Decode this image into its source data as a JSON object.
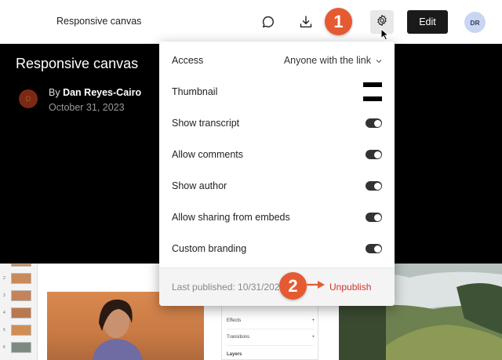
{
  "header": {
    "title": "Responsive canvas",
    "icons": [
      "comment-icon",
      "download-icon",
      "gear-icon"
    ],
    "edit_label": "Edit",
    "avatar_initials": "DR"
  },
  "hero": {
    "title": "Responsive canvas",
    "author_initial": "D",
    "by_prefix": "By",
    "author_name": "Dan Reyes-Cairo",
    "date": "October 31, 2023"
  },
  "callouts": [
    "1",
    "2"
  ],
  "settings": {
    "access_label": "Access",
    "access_value": "Anyone with the link",
    "thumbnail_label": "Thumbnail",
    "toggles": [
      {
        "label": "Show transcript",
        "on": true
      },
      {
        "label": "Allow comments",
        "on": true
      },
      {
        "label": "Show author",
        "on": true
      },
      {
        "label": "Allow sharing from embeds",
        "on": true
      },
      {
        "label": "Custom branding",
        "on": true
      }
    ],
    "last_published": "Last published: 10/31/2023",
    "unpublish_label": "Unpublish"
  },
  "canvas_preview": {
    "thumb_numbers": [
      "2",
      "3",
      "4",
      "5",
      "6"
    ],
    "panel_items": [
      "Effects",
      "Transitions",
      "Layers"
    ]
  },
  "colors": {
    "accent_callout": "#e65a32",
    "unpublish": "#d0342c",
    "edit_button": "#1a1a1a"
  }
}
